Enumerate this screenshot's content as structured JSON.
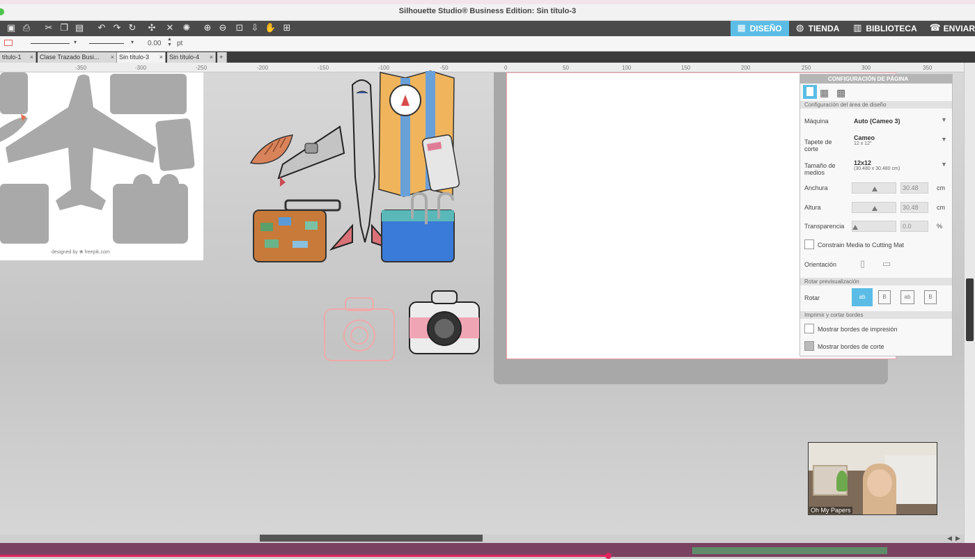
{
  "app": {
    "title": "Silhouette Studio® Business Edition: Sin título-3"
  },
  "nav_tabs": [
    {
      "label": "DISEÑO",
      "icon": "design-icon",
      "active": true
    },
    {
      "label": "TIENDA",
      "icon": "store-icon",
      "active": false
    },
    {
      "label": "BIBLIOTECA",
      "icon": "library-icon",
      "active": false
    },
    {
      "label": "ENVIAR",
      "icon": "send-icon",
      "active": false
    }
  ],
  "toolbar_icons": [
    "save-icon",
    "print-icon",
    "cut-icon",
    "copy-icon",
    "paste-icon",
    "undo-icon",
    "redo-icon",
    "rotate-icon",
    "select-icon",
    "delete-icon",
    "settings-icon",
    "zoom-in-icon",
    "zoom-out-icon",
    "zoom-select-icon",
    "move-down-icon",
    "pan-icon",
    "fit-page-icon"
  ],
  "propbar": {
    "line_width_value": "0.00",
    "line_width_unit": "pt"
  },
  "doc_tabs": [
    {
      "label": "título-1",
      "active": false
    },
    {
      "label": "Clase Trazado Busi...",
      "active": false
    },
    {
      "label": "Sin título-3",
      "active": true
    },
    {
      "label": "Sin título-4",
      "active": false
    }
  ],
  "ruler": {
    "ticks": [
      "-350",
      "-300",
      "-250",
      "-200",
      "-150",
      "-100",
      "-50",
      "0",
      "50",
      "100",
      "150",
      "200",
      "250",
      "300",
      "350"
    ]
  },
  "sheet": {
    "credit": "designed by ❀ freepik.com"
  },
  "panel": {
    "title": "CONFIGURACIÓN DE PÁGINA",
    "section_design": "Configuración del área de diseño",
    "machine_label": "Máquina",
    "machine_value": "Auto (Cameo 3)",
    "mat_label_1": "Tapete de",
    "mat_label_2": "corte",
    "mat_value": "Cameo",
    "mat_sub": "12 x 12\"",
    "media_label_1": "Tamaño de",
    "media_label_2": "medios",
    "media_value": "12x12",
    "media_sub": "(30.480 x 30.480 cm)",
    "width_label": "Anchura",
    "width_value": "30.48",
    "width_unit": "cm",
    "height_label": "Altura",
    "height_value": "30.48",
    "height_unit": "cm",
    "transparency_label": "Transparencia",
    "transparency_value": "0.0",
    "transparency_unit": "%",
    "constrain_label": "Constrain Media to Cutting Mat",
    "orientation_label": "Orientación",
    "section_rotate": "Rotar previsualización",
    "rotate_label": "Rotar",
    "rotate_options": [
      "ab",
      "B",
      "ab",
      "B"
    ],
    "section_print": "Imprimir y cortar bordes",
    "print_borders_label": "Mostrar bordes de impresión",
    "cut_borders_label": "Mostrar bordes de corte"
  },
  "webcam": {
    "label": "Oh My Papers"
  },
  "colors": {
    "accent": "#5bbde6",
    "toolbar": "#4a4a4a"
  }
}
